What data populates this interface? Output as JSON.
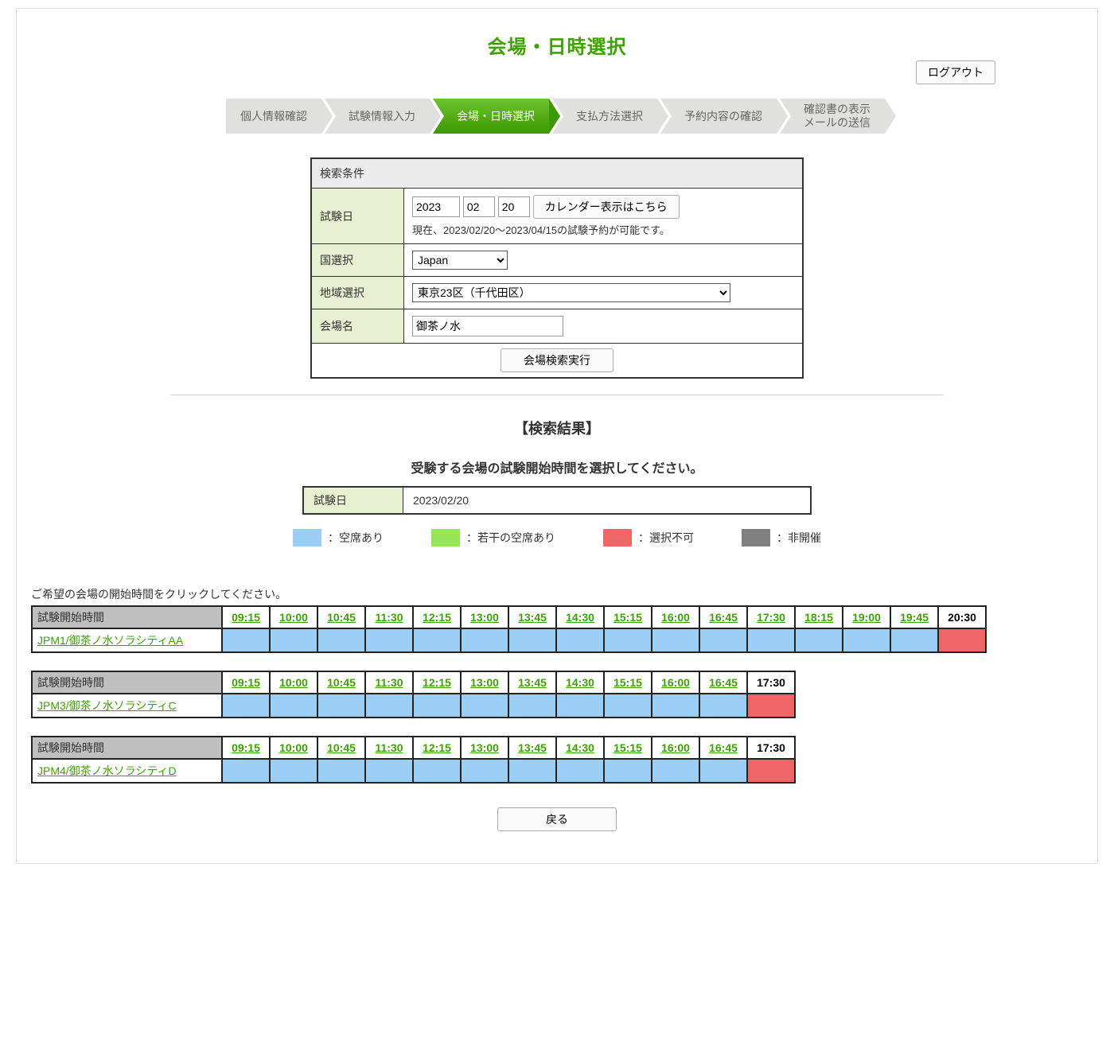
{
  "page": {
    "title": "会場・日時選択",
    "logout_label": "ログアウト"
  },
  "steps": [
    {
      "label": "個人情報確認",
      "active": false
    },
    {
      "label": "試験情報入力",
      "active": false
    },
    {
      "label": "会場・日時選択",
      "active": true
    },
    {
      "label": "支払方法選択",
      "active": false
    },
    {
      "label": "予約内容の確認",
      "active": false
    },
    {
      "label": "確認書の表示\nメールの送信",
      "active": false
    }
  ],
  "search": {
    "header": "検索条件",
    "labels": {
      "exam_date": "試験日",
      "country": "国選択",
      "region": "地域選択",
      "venue": "会場名"
    },
    "date": {
      "year": "2023",
      "month": "02",
      "day": "20"
    },
    "calendar_button": "カレンダー表示はこちら",
    "date_note": "現在、2023/02/20～2023/04/15の試験予約が可能です。",
    "country_value": "Japan",
    "region_value": "東京23区（千代田区）",
    "venue_value": "御茶ノ水",
    "search_button": "会場検索実行"
  },
  "results": {
    "title": "【検索結果】",
    "subtitle": "受験する会場の試験開始時間を選択してください。",
    "date_label": "試験日",
    "date_value": "2023/02/20"
  },
  "legend": {
    "available": "：空席あり",
    "few": "：若干の空席あり",
    "unavailable": "：選択不可",
    "closed": "：非開催"
  },
  "schedule": {
    "click_note": "ご希望の会場の開始時間をクリックしてください。",
    "header_label": "試験開始時間",
    "tables": [
      {
        "venue": "JPM1/御茶ノ水ソラシティAA",
        "times": [
          "09:15",
          "10:00",
          "10:45",
          "11:30",
          "12:15",
          "13:00",
          "13:45",
          "14:30",
          "15:15",
          "16:00",
          "16:45",
          "17:30",
          "18:15",
          "19:00",
          "19:45",
          "20:30"
        ],
        "time_link": [
          true,
          true,
          true,
          true,
          true,
          true,
          true,
          true,
          true,
          true,
          true,
          true,
          true,
          true,
          true,
          false
        ],
        "slots": [
          "available",
          "available",
          "available",
          "available",
          "available",
          "available",
          "available",
          "available",
          "available",
          "available",
          "available",
          "available",
          "available",
          "available",
          "available",
          "unavailable"
        ]
      },
      {
        "venue": "JPM3/御茶ノ水ソラシティC",
        "times": [
          "09:15",
          "10:00",
          "10:45",
          "11:30",
          "12:15",
          "13:00",
          "13:45",
          "14:30",
          "15:15",
          "16:00",
          "16:45",
          "17:30"
        ],
        "time_link": [
          true,
          true,
          true,
          true,
          true,
          true,
          true,
          true,
          true,
          true,
          true,
          false
        ],
        "slots": [
          "available",
          "available",
          "available",
          "available",
          "available",
          "available",
          "available",
          "available",
          "available",
          "available",
          "available",
          "unavailable"
        ]
      },
      {
        "venue": "JPM4/御茶ノ水ソラシティD",
        "times": [
          "09:15",
          "10:00",
          "10:45",
          "11:30",
          "12:15",
          "13:00",
          "13:45",
          "14:30",
          "15:15",
          "16:00",
          "16:45",
          "17:30"
        ],
        "time_link": [
          true,
          true,
          true,
          true,
          true,
          true,
          true,
          true,
          true,
          true,
          true,
          false
        ],
        "slots": [
          "available",
          "available",
          "available",
          "available",
          "available",
          "available",
          "available",
          "available",
          "available",
          "available",
          "available",
          "unavailable"
        ]
      }
    ]
  },
  "footer": {
    "back_label": "戻る"
  }
}
